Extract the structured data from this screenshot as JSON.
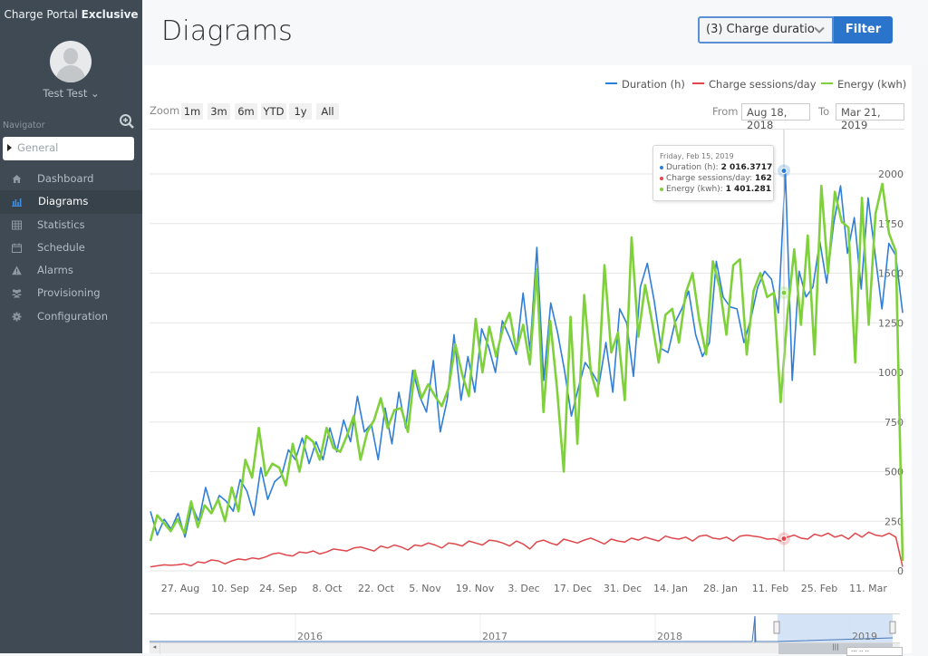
{
  "sidebar": {
    "brand_prefix": "Charge Portal",
    "brand_bold": "Exclusive",
    "user_name": "Test Test ⌄",
    "navigator_label": "Navigator",
    "navigator_search_icon": "zoom-in-icon",
    "general_label": "General",
    "items": [
      {
        "label": "Dashboard",
        "icon": "home-icon",
        "active": false
      },
      {
        "label": "Diagrams",
        "icon": "bar-chart-icon",
        "active": true
      },
      {
        "label": "Statistics",
        "icon": "table-icon",
        "active": false
      },
      {
        "label": "Schedule",
        "icon": "calendar-icon",
        "active": false
      },
      {
        "label": "Alarms",
        "icon": "warning-icon",
        "active": false
      },
      {
        "label": "Provisioning",
        "icon": "users-icon",
        "active": false
      },
      {
        "label": "Configuration",
        "icon": "gear-icon",
        "active": false
      }
    ]
  },
  "header": {
    "title": "Diagrams",
    "select_value": "(3) Charge duratio",
    "filter_label": "Filter"
  },
  "toolbar": {
    "zoom_label": "Zoom",
    "zoom_buttons": [
      "1m",
      "3m",
      "6m",
      "YTD",
      "1y",
      "All"
    ],
    "from_label": "From",
    "from_value": "Aug 18, 2018",
    "to_label": "To",
    "to_value": "Mar 21, 2019"
  },
  "tooltip": {
    "date": "Friday, Feb 15, 2019",
    "rows": [
      {
        "label": "Duration (h):",
        "value": "2 016.3717",
        "color": "#2f7ed8"
      },
      {
        "label": "Charge sessions/day:",
        "value": "162",
        "color": "#e0474c"
      },
      {
        "label": "Energy (kwh):",
        "value": "1 401.281",
        "color": "#7fd13b"
      }
    ]
  },
  "navigator": {
    "years": [
      "2016",
      "2017",
      "2018",
      "2019"
    ],
    "selected_range": [
      "Aug 18, 2018",
      "Mar 21, 2019"
    ]
  },
  "chart_data": {
    "type": "line",
    "title": "",
    "xlabel": "",
    "ylabel": "",
    "x_start": "2018-08-18",
    "x_end": "2019-03-21",
    "x_tick_labels": [
      "27. Aug",
      "10. Sep",
      "24. Sep",
      "8. Oct",
      "22. Oct",
      "5. Nov",
      "19. Nov",
      "3. Dec",
      "17. Dec",
      "31. Dec",
      "14. Jan",
      "28. Jan",
      "11. Feb",
      "25. Feb",
      "11. Mar"
    ],
    "y_tick_labels": [
      "0",
      "250",
      "500",
      "750",
      "1000",
      "1250",
      "1500",
      "1750",
      "2000"
    ],
    "ylim": [
      0,
      2250
    ],
    "grid": true,
    "legend": "top-right",
    "sample_interval_days": 3,
    "series": [
      {
        "name": "Duration (h)",
        "color": "#2f7ed8",
        "values": [
          300,
          180,
          260,
          210,
          290,
          170,
          330,
          250,
          420,
          300,
          380,
          350,
          300,
          460,
          400,
          280,
          520,
          360,
          450,
          480,
          610,
          560,
          670,
          540,
          650,
          560,
          720,
          600,
          760,
          650,
          880,
          700,
          740,
          560,
          820,
          640,
          900,
          720,
          1010,
          880,
          800,
          1060,
          700,
          860,
          1190,
          860,
          1080,
          900,
          1220,
          1130,
          1000,
          1260,
          1180,
          1090,
          1400,
          1110,
          1630,
          960,
          1350,
          1200,
          1010,
          780,
          920,
          1050,
          1000,
          940,
          1150,
          900,
          1320,
          1250,
          980,
          1430,
          1550,
          1360,
          1120,
          1100,
          1250,
          1320,
          1410,
          1190,
          1080,
          1150,
          1560,
          1380,
          1330,
          1320,
          1150,
          1270,
          1430,
          1510,
          1470,
          1300,
          2016,
          960,
          1510,
          1380,
          1430,
          1660,
          1450,
          1750,
          1940,
          1600,
          1780,
          1420,
          1880,
          1600,
          1320,
          1650,
          1590,
          1300
        ]
      },
      {
        "name": "Charge sessions/day",
        "color": "#e0474c",
        "values": [
          20,
          25,
          30,
          28,
          30,
          35,
          25,
          45,
          40,
          55,
          50,
          35,
          50,
          60,
          55,
          65,
          60,
          70,
          85,
          90,
          80,
          75,
          95,
          90,
          100,
          85,
          95,
          110,
          105,
          100,
          115,
          120,
          110,
          100,
          125,
          115,
          130,
          120,
          105,
          130,
          125,
          140,
          130,
          115,
          140,
          135,
          125,
          150,
          140,
          130,
          155,
          150,
          140,
          125,
          150,
          135,
          110,
          145,
          155,
          140,
          130,
          160,
          150,
          140,
          155,
          165,
          150,
          135,
          160,
          150,
          145,
          165,
          155,
          170,
          160,
          150,
          175,
          165,
          160,
          170,
          150,
          175,
          180,
          165,
          160,
          170,
          150,
          175,
          180,
          175,
          170,
          160,
          162,
          150,
          170,
          180,
          165,
          160,
          185,
          175,
          190,
          170,
          180,
          160,
          190,
          170,
          195,
          180,
          175,
          190,
          170,
          20
        ]
      },
      {
        "name": "Energy (kwh)",
        "color": "#7fd13b",
        "values": [
          150,
          280,
          240,
          200,
          260,
          190,
          350,
          220,
          330,
          290,
          360,
          250,
          420,
          300,
          560,
          470,
          720,
          480,
          540,
          520,
          430,
          640,
          500,
          680,
          650,
          560,
          720,
          620,
          600,
          680,
          780,
          560,
          700,
          760,
          870,
          720,
          810,
          820,
          700,
          1010,
          870,
          940,
          880,
          830,
          920,
          1140,
          990,
          880,
          1270,
          1000,
          1230,
          1080,
          1220,
          1300,
          1110,
          1240,
          1040,
          1520,
          800,
          1260,
          920,
          500,
          1280,
          640,
          1390,
          1000,
          880,
          1540,
          1100,
          1200,
          860,
          1680,
          1180,
          1440,
          1260,
          1050,
          1290,
          1320,
          1150,
          1400,
          1500,
          1260,
          1090,
          1560,
          1430,
          1190,
          1540,
          1570,
          1090,
          1410,
          1500,
          1380,
          1401,
          850,
          1290,
          1620,
          1240,
          1690,
          1090,
          1940,
          1500,
          1910,
          1760,
          1730,
          1050,
          1880,
          1240,
          1800,
          1950,
          1700,
          1610,
          50
        ]
      }
    ]
  }
}
